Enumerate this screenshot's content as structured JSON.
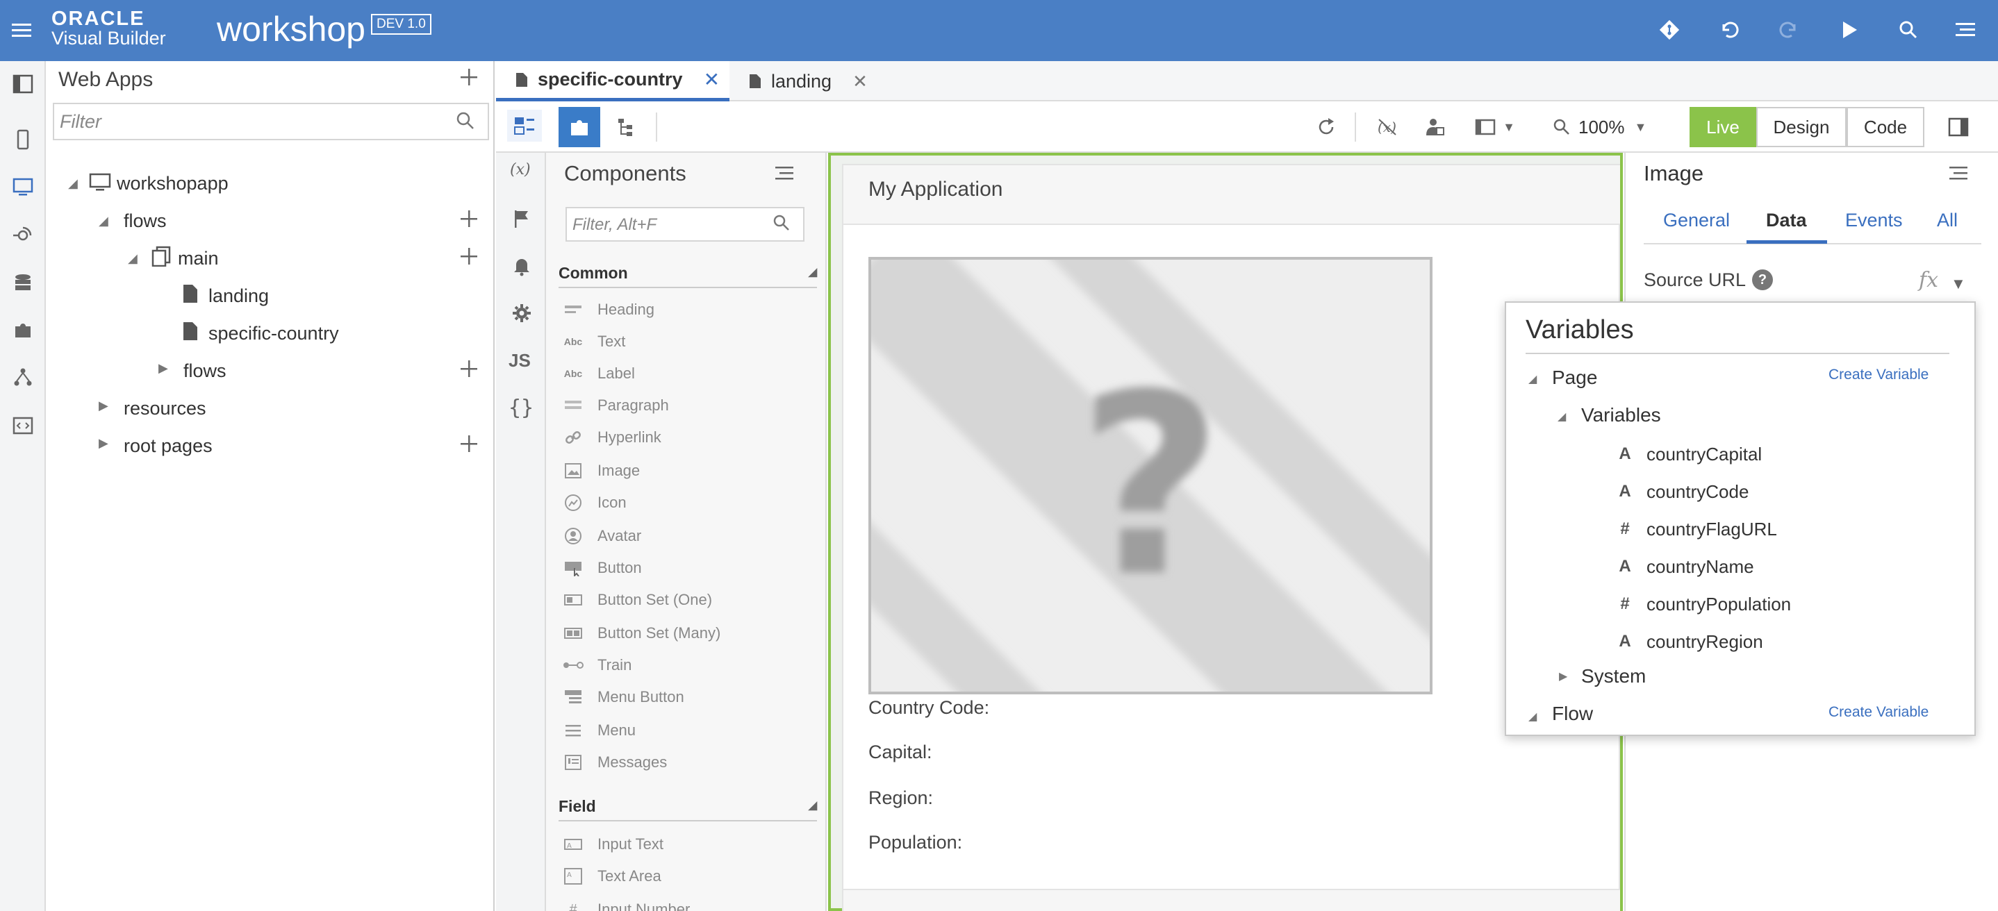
{
  "header": {
    "oracle_logo": "ORACLE",
    "product": "Visual Builder",
    "app_name": "workshop",
    "version": "DEV 1.0"
  },
  "webapps": {
    "title": "Web Apps",
    "filter_placeholder": "Filter",
    "tree": {
      "workshopapp": "workshopapp",
      "flows": "flows",
      "main": "main",
      "landing": "landing",
      "specific_country": "specific-country",
      "sub_flows": "flows",
      "resources": "resources",
      "root_pages": "root pages"
    }
  },
  "tabs": [
    {
      "label": "specific-country",
      "active": true
    },
    {
      "label": "landing",
      "active": false
    }
  ],
  "toolbar": {
    "zoom": "100%",
    "live": "Live",
    "design": "Design",
    "code": "Code"
  },
  "components": {
    "title": "Components",
    "filter_placeholder": "Filter, Alt+F",
    "common_header": "Common",
    "field_header": "Field",
    "common": [
      "Heading",
      "Text",
      "Label",
      "Paragraph",
      "Hyperlink",
      "Image",
      "Icon",
      "Avatar",
      "Button",
      "Button Set (One)",
      "Button Set (Many)",
      "Train",
      "Menu Button",
      "Menu",
      "Messages"
    ],
    "field": [
      "Input Text",
      "Text Area",
      "Input Number"
    ]
  },
  "canvas": {
    "app_title": "My Application",
    "placeholder_glyph": "?",
    "labels": {
      "country_code": "Country Code:",
      "capital": "Capital:",
      "region": "Region:",
      "population": "Population:"
    }
  },
  "properties": {
    "title": "Image",
    "tabs": [
      "General",
      "Data",
      "Events",
      "All"
    ],
    "active_tab": "Data",
    "source_url_label": "Source URL",
    "fx": "fx"
  },
  "variables_popup": {
    "title": "Variables",
    "page": "Page",
    "create_variable": "Create Variable",
    "variables_group": "Variables",
    "items": [
      {
        "type": "A",
        "name": "countryCapital"
      },
      {
        "type": "A",
        "name": "countryCode"
      },
      {
        "type": "#",
        "name": "countryFlagURL"
      },
      {
        "type": "A",
        "name": "countryName"
      },
      {
        "type": "#",
        "name": "countryPopulation"
      },
      {
        "type": "A",
        "name": "countryRegion"
      }
    ],
    "system": "System",
    "flow": "Flow"
  },
  "colors": {
    "header_bg": "#4a7fc5",
    "accent": "#3a6fbf",
    "live_bg": "#8bc34a",
    "canvas_border": "#8bc34a"
  }
}
